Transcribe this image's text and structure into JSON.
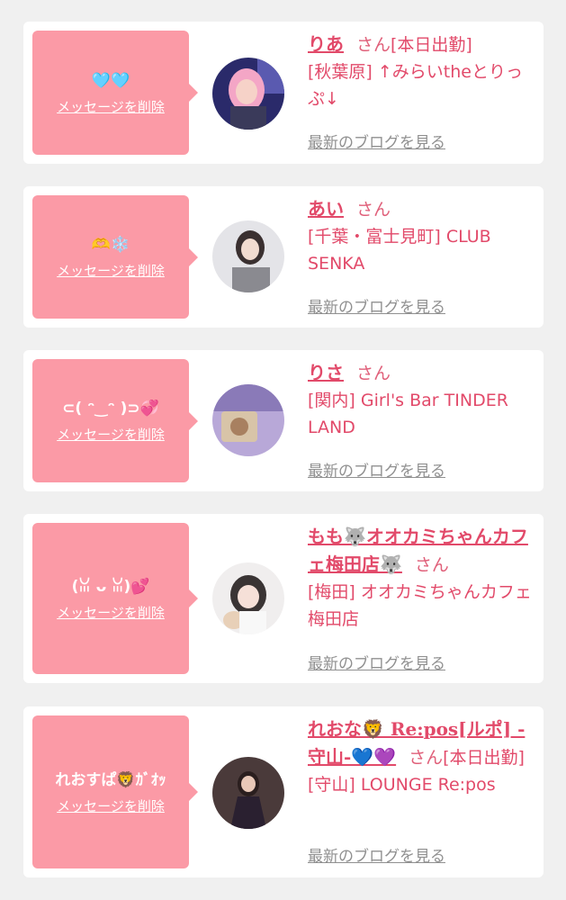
{
  "delete_label": "メッセージを削除",
  "blog_label": "最新のブログを見る",
  "san": "さん",
  "items": [
    {
      "message": "🩵🩵",
      "name": "りあ",
      "status": "[本日出勤]",
      "shop": "[秋葉原] ↑みらいtheとりっぷ↓"
    },
    {
      "message": "🫶❄️",
      "name": "あい",
      "status": "",
      "shop": "[千葉・富士見町] CLUB SENKA"
    },
    {
      "message": "⊂( ᵔ‿ᵔ )⊃💞",
      "name": "りさ",
      "status": "",
      "shop": "[関内] Girl's Bar TINDER LAND"
    },
    {
      "message": "(ꈍ ᴗ ꈍ)💕",
      "name": "もも🐺オオカミちゃんカフェ梅田店🐺",
      "status": "",
      "shop": "[梅田] オオカミちゃんカフェ梅田店"
    },
    {
      "message": "れおすぱ🦁ｶﾞｵｯ",
      "name": "れおな🦁 Re:pos[ルポ] -守山-💙💜",
      "status": "[本日出勤]",
      "shop": "[守山] LOUNGE Re:pos"
    }
  ]
}
